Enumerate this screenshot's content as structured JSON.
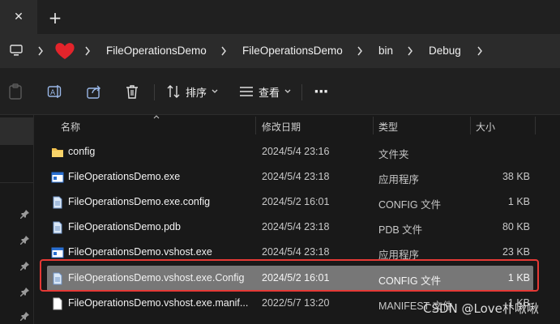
{
  "titlebar": {
    "close_glyph": "✕",
    "newtab_glyph": "+"
  },
  "address": {
    "crumbs": [
      "FileOperationsDemo",
      "FileOperationsDemo",
      "bin",
      "Debug"
    ]
  },
  "toolbar": {
    "sort_label": "排序",
    "view_label": "查看",
    "more_glyph": "···"
  },
  "columns": {
    "name": "名称",
    "date": "修改日期",
    "type": "类型",
    "size": "大小"
  },
  "files": [
    {
      "icon": "folder-icon",
      "name": "config",
      "date": "2024/5/4 23:16",
      "type": "文件夹",
      "size": ""
    },
    {
      "icon": "exe-icon",
      "name": "FileOperationsDemo.exe",
      "date": "2024/5/4 23:18",
      "type": "应用程序",
      "size": "38 KB"
    },
    {
      "icon": "config-file-icon",
      "name": "FileOperationsDemo.exe.config",
      "date": "2024/5/2 16:01",
      "type": "CONFIG 文件",
      "size": "1 KB"
    },
    {
      "icon": "pdb-file-icon",
      "name": "FileOperationsDemo.pdb",
      "date": "2024/5/4 23:18",
      "type": "PDB 文件",
      "size": "80 KB"
    },
    {
      "icon": "exe-icon",
      "name": "FileOperationsDemo.vshost.exe",
      "date": "2024/5/4 23:18",
      "type": "应用程序",
      "size": "23 KB"
    },
    {
      "icon": "config-file-icon",
      "name": "FileOperationsDemo.vshost.exe.Config",
      "date": "2024/5/2 16:01",
      "type": "CONFIG 文件",
      "size": "1 KB"
    },
    {
      "icon": "manifest-file-icon",
      "name": "FileOperationsDemo.vshost.exe.manif...",
      "date": "2022/5/7 13:20",
      "type": "MANIFEST 文件",
      "size": "1 KB"
    }
  ],
  "watermark": "CSDN @Love朴啾啾",
  "colors": {
    "highlight": "#e53935",
    "selected_row": "#777777",
    "folder": "#f2c14e"
  }
}
